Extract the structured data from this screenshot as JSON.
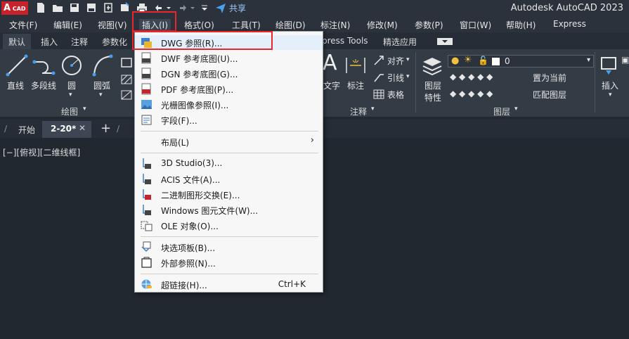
{
  "app": {
    "logo_text": "A",
    "logo_sub": "CAD",
    "title": "Autodesk AutoCAD 2023",
    "share_label": "共享"
  },
  "menubar": {
    "items": [
      "文件(F)",
      "编辑(E)",
      "视图(V)",
      "插入(I)",
      "格式(O)",
      "工具(T)",
      "绘图(D)",
      "标注(N)",
      "修改(M)",
      "参数(P)",
      "窗口(W)",
      "帮助(H)",
      "Express"
    ],
    "active": "插入(I)"
  },
  "ribbon_tabs": {
    "items": [
      "默认",
      "插入",
      "注释",
      "参数化"
    ],
    "right_items": [
      "press Tools",
      "精选应用"
    ],
    "active": "默认"
  },
  "ribbon": {
    "draw": {
      "line": "直线",
      "polyline": "多段线",
      "circle": "圆",
      "arc": "圆弧",
      "panel_title": "绘图"
    },
    "annotation": {
      "text": "文字",
      "dimension": "标注",
      "align": "对齐",
      "leader": "引线",
      "table": "表格",
      "panel_title": "注释"
    },
    "layers": {
      "layer_props_line1": "图层",
      "layer_props_line2": "特性",
      "current_layer_value": "0",
      "set_current": "置为当前",
      "match_layer": "匹配图层",
      "panel_title": "图层"
    },
    "insert": {
      "label": "插入"
    }
  },
  "doc_tabs": {
    "start": "开始",
    "active_doc": "2-20*",
    "add": "+"
  },
  "viewport": {
    "label": "[−][俯视][二维线框]"
  },
  "dropdown": {
    "items": [
      {
        "label": "DWG 参照(R)...",
        "icon": "dwg-reference-icon"
      },
      {
        "label": "DWF 参考底图(U)...",
        "icon": "dwf-underlay-icon"
      },
      {
        "label": "DGN 参考底图(G)...",
        "icon": "dgn-underlay-icon"
      },
      {
        "label": "PDF 参考底图(P)...",
        "icon": "pdf-underlay-icon"
      },
      {
        "label": "光栅图像参照(I)...",
        "icon": "raster-image-icon"
      },
      {
        "label": "字段(F)...",
        "icon": "field-icon"
      },
      {
        "label": "布局(L)",
        "icon": "",
        "submenu": true
      },
      {
        "label": "3D Studio(3)...",
        "icon": "3d-studio-icon"
      },
      {
        "label": "ACIS 文件(A)...",
        "icon": "acis-file-icon"
      },
      {
        "label": "二进制图形交换(E)...",
        "icon": "dxb-icon"
      },
      {
        "label": "Windows 图元文件(W)...",
        "icon": "wmf-icon"
      },
      {
        "label": "OLE 对象(O)...",
        "icon": "ole-object-icon"
      },
      {
        "label": "块选项板(B)...",
        "icon": "block-palette-icon"
      },
      {
        "label": "外部参照(N)...",
        "icon": "external-references-icon"
      },
      {
        "label": "超链接(H)...",
        "icon": "hyperlink-icon",
        "shortcut": "Ctrl+K"
      }
    ]
  },
  "colors": {
    "highlight_box": "#e8262c",
    "logo_red": "#c8232c",
    "menu_bg": "#f7f7f7"
  }
}
